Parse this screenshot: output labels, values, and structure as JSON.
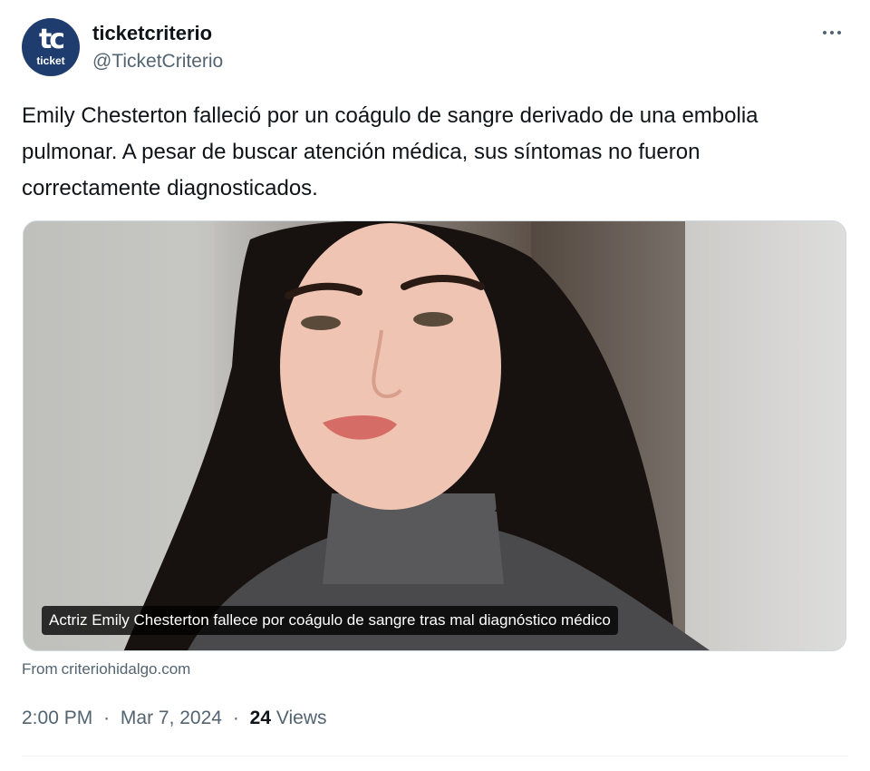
{
  "author": {
    "display_name": "ticketcriterio",
    "handle": "@TicketCriterio",
    "avatar_text": "tc",
    "avatar_subtext": "ticket"
  },
  "more_icon": "more-horizontal-icon",
  "tweet": {
    "text": "Emily Chesterton falleció por un coágulo de sangre derivado de una embolia pulmonar. A pesar de buscar atención médica, sus síntomas no fueron correctamente diagnosticados."
  },
  "card": {
    "caption": "Actriz Emily Chesterton fallece por coágulo de sangre tras mal diagnóstico médico",
    "source_label": "From",
    "source_domain": "criteriohidalgo.com"
  },
  "meta": {
    "time": "2:00 PM",
    "date": "Mar 7, 2024",
    "separator": "·",
    "views_count": "24",
    "views_label": "Views"
  },
  "colors": {
    "text_primary": "#0f1419",
    "text_secondary": "#536471",
    "avatar_bg": "#1f3c6e",
    "divider": "#eff3f4"
  }
}
